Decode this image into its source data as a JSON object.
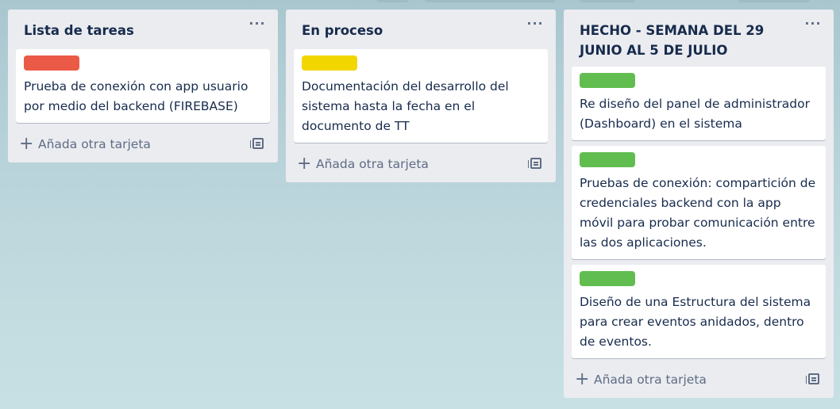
{
  "lists": [
    {
      "title": "Lista de tareas",
      "menu": "···",
      "cards": [
        {
          "label_color": "#eb5a46",
          "text": "Prueba de conexión con app usuario por medio del backend (FIREBASE)"
        }
      ],
      "add_card": "Añada otra tarjeta"
    },
    {
      "title": "En proceso",
      "menu": "···",
      "cards": [
        {
          "label_color": "#f2d600",
          "text": "Documentación del desarrollo del sistema hasta la fecha en el documento de TT"
        }
      ],
      "add_card": "Añada otra tarjeta"
    },
    {
      "title": "HECHO - SEMANA DEL 29 JUNIO AL 5 DE JULIO",
      "menu": "···",
      "cards": [
        {
          "label_color": "#61bd4f",
          "text": "Re diseño del panel de administrador (Dashboard) en el sistema"
        },
        {
          "label_color": "#61bd4f",
          "text": "Pruebas de conexión: compartición de credenciales backend con la app móvil para probar comunicación entre las dos aplicaciones."
        },
        {
          "label_color": "#61bd4f",
          "text": "Diseño de una Estructura del sistema para crear eventos anidados, dentro de eventos."
        }
      ],
      "add_card": "Añada otra tarjeta"
    }
  ],
  "icons": {
    "add": "plus-icon",
    "template": "card-template-icon",
    "menu": "more-horizontal-icon"
  },
  "colors": {
    "list_background": "#ebecf0",
    "card_background": "#ffffff",
    "text": "#172b4d",
    "muted_text": "#5e6c84"
  }
}
